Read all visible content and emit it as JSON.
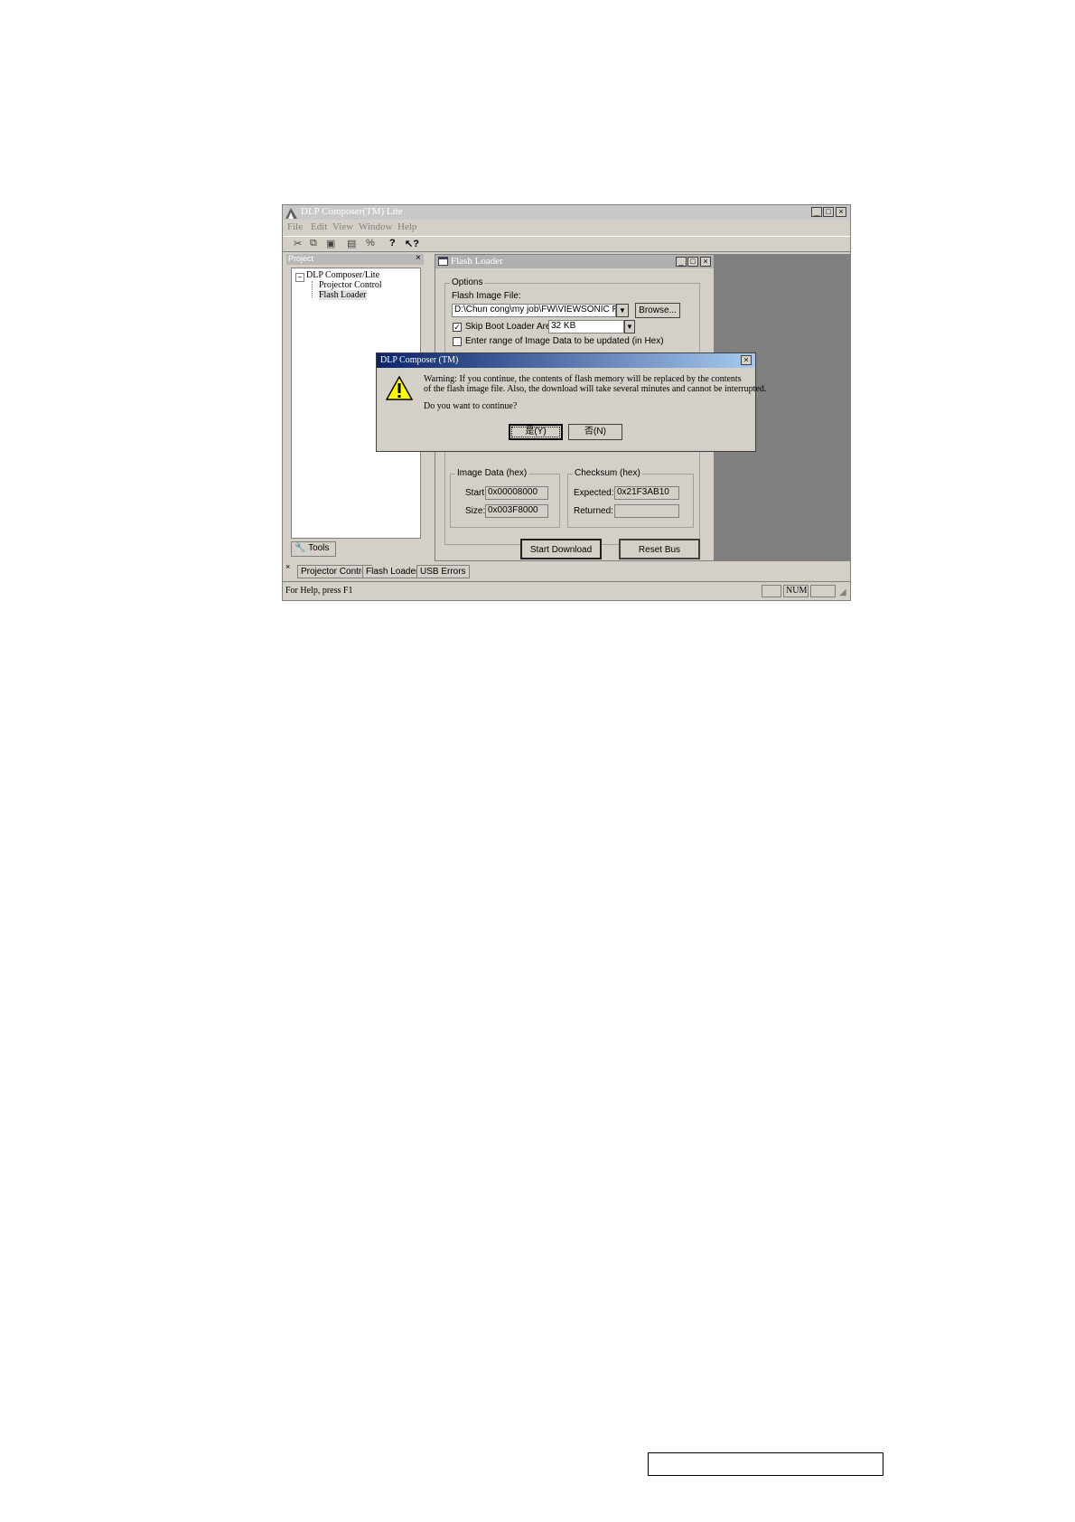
{
  "main_window": {
    "title": "DLP Composer(TM) Lite",
    "menu": [
      "File",
      "Edit",
      "View",
      "Window",
      "Help"
    ],
    "toolbar_icons": [
      "cut-icon",
      "copy-icon",
      "paste-icon",
      "properties-icon",
      "percent-icon",
      "help-icon",
      "context-help-icon"
    ]
  },
  "project_panel": {
    "title": "Project",
    "tree_root": "DLP Composer/Lite",
    "tree_children": [
      "Projector Control",
      "Flash Loader"
    ],
    "tab_label": "Tools"
  },
  "flash_loader": {
    "title": "Flash Loader",
    "options_label": "Options",
    "flash_image_label": "Flash Image File:",
    "flash_image_value": "D:\\Chun cong\\my job\\FW\\VIEWSONIC FW\\l",
    "browse_label": "Browse...",
    "skip_boot_label": "Skip Boot Loader Area:",
    "skip_boot_value": "32 KB",
    "enter_range_label": "Enter range of Image Data to be updated (in Hex)",
    "image_data": {
      "label": "Image Data (hex)",
      "start_label": "Start:",
      "start_value": "0x00008000",
      "size_label": "Size:",
      "size_value": "0x003F8000"
    },
    "checksum": {
      "label": "Checksum (hex)",
      "expected_label": "Expected:",
      "expected_value": "0x21F3AB10",
      "returned_label": "Returned:",
      "returned_value": ""
    },
    "start_download_label": "Start Download",
    "reset_bus_label": "Reset Bus"
  },
  "dialog": {
    "title": "DLP Composer (TM)",
    "message_line1": "Warning: If you continue, the contents of flash memory will be replaced by the contents",
    "message_line2": "of the flash image file.  Also, the download will take several minutes and cannot be interrupted.",
    "question": "Do you want to continue?",
    "yes_label": "是(Y)",
    "no_label": "否(N)"
  },
  "window_tabs": [
    "Projector Control",
    "Flash Loader",
    "USB Errors"
  ],
  "status": {
    "help_text": "For Help, press F1",
    "num_indicator": "NUM"
  },
  "colors": {
    "window_bg": "#d4d0c8",
    "dialog_title_start": "#0a246a",
    "mdi_background": "#808080"
  }
}
